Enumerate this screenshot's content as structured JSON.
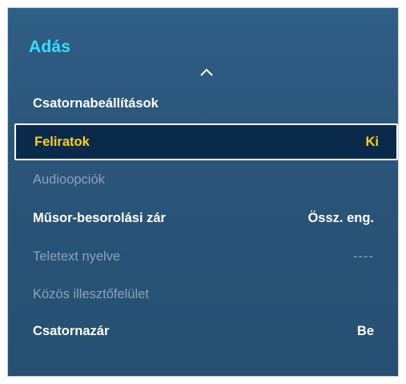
{
  "panel": {
    "title": "Adás"
  },
  "menu": {
    "items": [
      {
        "label": "Csatornabeállítások",
        "value": "",
        "state": "enabled"
      },
      {
        "label": "Feliratok",
        "value": "Ki",
        "state": "selected"
      },
      {
        "label": "Audioopciók",
        "value": "",
        "state": "disabled"
      },
      {
        "label": "Műsor-besorolási zár",
        "value": "Össz. eng.",
        "state": "enabled"
      },
      {
        "label": "Teletext nyelve",
        "value": "----",
        "state": "disabled"
      },
      {
        "label": "Közös illesztőfelület",
        "value": "",
        "state": "disabled"
      },
      {
        "label": "Csatornazár",
        "value": "Be",
        "state": "enabled"
      }
    ]
  },
  "icons": {
    "scroll_up": "chevron-up-icon"
  },
  "colors": {
    "panel_bg": "#2a5478",
    "title": "#36e0ff",
    "selected_bg": "#0a2a4b",
    "selected_text": "#ffd200",
    "disabled_text": "#8aa3bb",
    "enabled_text": "#ffffff"
  }
}
